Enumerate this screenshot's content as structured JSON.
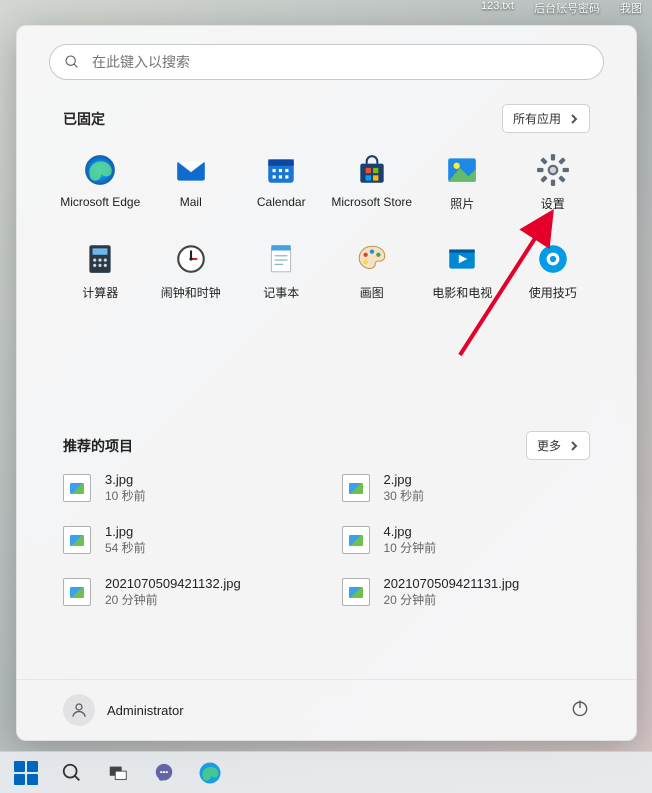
{
  "desktop_files": [
    "123.txt",
    "后台账号密码",
    "我图"
  ],
  "search": {
    "placeholder": "在此键入以搜索"
  },
  "pinned": {
    "title": "已固定",
    "all_apps_label": "所有应用",
    "apps": [
      {
        "name": "Microsoft Edge",
        "icon": "edge"
      },
      {
        "name": "Mail",
        "icon": "mail"
      },
      {
        "name": "Calendar",
        "icon": "calendar"
      },
      {
        "name": "Microsoft Store",
        "icon": "store"
      },
      {
        "name": "照片",
        "icon": "photos"
      },
      {
        "name": "设置",
        "icon": "settings"
      },
      {
        "name": "计算器",
        "icon": "calculator"
      },
      {
        "name": "闹钟和时钟",
        "icon": "clock"
      },
      {
        "name": "记事本",
        "icon": "notepad"
      },
      {
        "name": "画图",
        "icon": "paint"
      },
      {
        "name": "电影和电视",
        "icon": "movies"
      },
      {
        "name": "使用技巧",
        "icon": "tips"
      }
    ]
  },
  "recommended": {
    "title": "推荐的项目",
    "more_label": "更多",
    "items": [
      {
        "name": "3.jpg",
        "time": "10 秒前"
      },
      {
        "name": "2.jpg",
        "time": "30 秒前"
      },
      {
        "name": "1.jpg",
        "time": "54 秒前"
      },
      {
        "name": "4.jpg",
        "time": "10 分钟前"
      },
      {
        "name": "2021070509421132.jpg",
        "time": "20 分钟前"
      },
      {
        "name": "2021070509421131.jpg",
        "time": "20 分钟前"
      }
    ]
  },
  "user": {
    "name": "Administrator"
  }
}
